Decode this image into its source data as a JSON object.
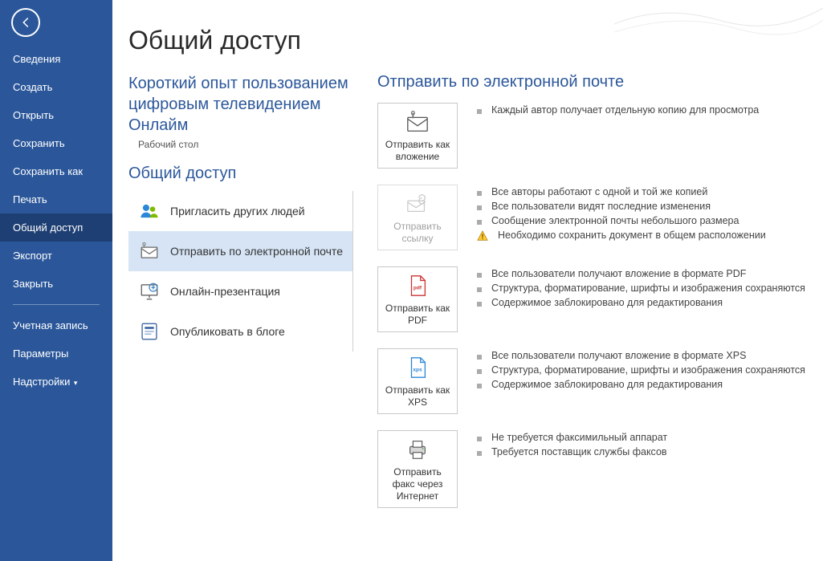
{
  "nav": {
    "items": [
      "Сведения",
      "Создать",
      "Открыть",
      "Сохранить",
      "Сохранить как",
      "Печать",
      "Общий доступ",
      "Экспорт",
      "Закрыть"
    ],
    "account": "Учетная запись",
    "options": "Параметры",
    "addins": "Надстройки"
  },
  "page": {
    "title": "Общий доступ"
  },
  "doc": {
    "title": "Короткий опыт пользованием цифровым телевидением Онлайм",
    "location": "Рабочий стол"
  },
  "share": {
    "heading": "Общий доступ",
    "items": [
      "Пригласить других людей",
      "Отправить по электронной почте",
      "Онлайн-презентация",
      "Опубликовать в блоге"
    ]
  },
  "email": {
    "heading": "Отправить по электронной почте",
    "options": [
      {
        "label": "Отправить как вложение",
        "bullets": [
          "Каждый автор получает отдельную копию для просмотра"
        ]
      },
      {
        "label": "Отправить ссылку",
        "disabled": true,
        "bullets": [
          "Все авторы работают с одной и той же копией",
          "Все пользователи видят последние изменения",
          "Сообщение электронной почты небольшого размера"
        ],
        "warning": "Необходимо сохранить документ в общем расположении"
      },
      {
        "label": "Отправить как PDF",
        "bullets": [
          "Все пользователи получают вложение в формате PDF",
          "Структура, форматирование, шрифты и изображения сохраняются",
          "Содержимое заблокировано для редактирования"
        ]
      },
      {
        "label": "Отправить как XPS",
        "bullets": [
          "Все пользователи получают вложение в формате XPS",
          "Структура, форматирование, шрифты и изображения сохраняются",
          "Содержимое заблокировано для редактирования"
        ]
      },
      {
        "label": "Отправить факс через Интернет",
        "bullets": [
          "Не требуется факсимильный аппарат",
          "Требуется поставщик службы факсов"
        ]
      }
    ]
  }
}
